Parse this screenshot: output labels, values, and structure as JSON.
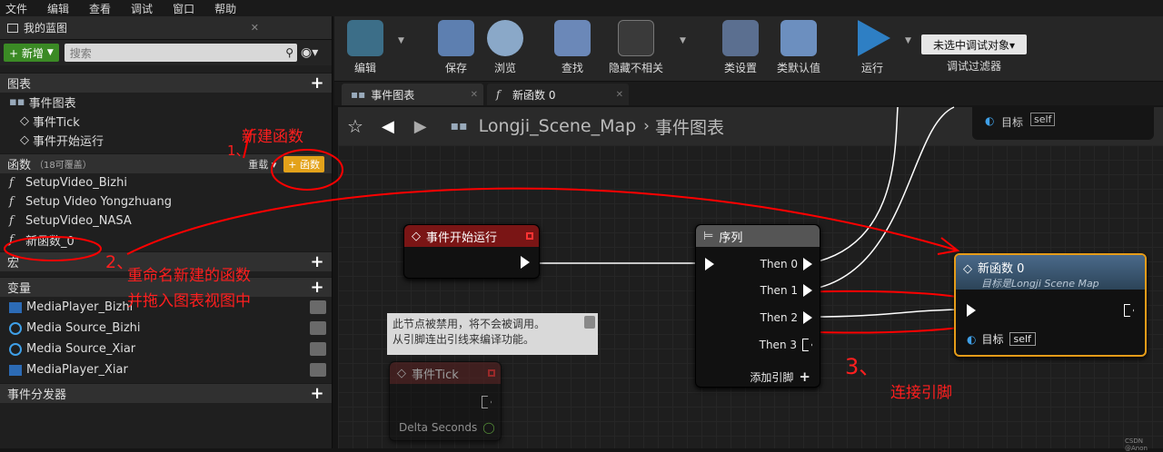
{
  "menu": [
    "文件",
    "编辑",
    "查看",
    "调试",
    "窗口",
    "帮助"
  ],
  "panel": {
    "title": "我的蓝图",
    "new_label": "+ 新增",
    "search_placeholder": "搜索",
    "graph_section": "图表",
    "event_graph": "事件图表",
    "event_tick": "事件Tick",
    "event_begin": "事件开始运行",
    "func_section": "函数",
    "func_note": "（18可覆盖）",
    "override": "重载",
    "add_func": "函数",
    "functions": [
      "SetupVideo_Bizhi",
      "Setup Video Yongzhuang",
      "SetupVideo_NASA",
      "新函数_0"
    ],
    "macro": "宏",
    "var_section": "变量",
    "variables": [
      "MediaPlayer_Bizhi",
      "Media Source_Bizhi",
      "Media Source_Xiar",
      "MediaPlayer_Xiar"
    ],
    "dispatcher": "事件分发器"
  },
  "toolbar": {
    "compile": "编辑",
    "save": "保存",
    "browse": "浏览",
    "find": "查找",
    "hide": "隐藏不相关",
    "class_settings": "类设置",
    "class_defaults": "类默认值",
    "play": "运行",
    "debug_select": "未选中调试对象▾",
    "debug_filter": "调试过滤器"
  },
  "tabs": [
    "事件图表",
    "新函数 0"
  ],
  "breadcrumb": {
    "map": "Longji_Scene_Map",
    "graph": "事件图表"
  },
  "nodes": {
    "begin": "事件开始运行",
    "seq": "序列",
    "then": [
      "Then 0",
      "Then 1",
      "Then 2",
      "Then 3"
    ],
    "add_pin": "添加引脚",
    "func": "新函数 0",
    "func_sub": "目标是Longji Scene Map",
    "target": "目标",
    "self": "self",
    "tick": "事件Tick",
    "delta": "Delta Seconds",
    "disabled_note": "此节点被禁用，将不会被调用。\n从引脚连出引线来编译功能。",
    "top_target": "目标",
    "top_self": "self"
  },
  "annotations": {
    "a1": "新建函数",
    "n1": "1、",
    "a2": "重命名新建的函数\n并拖入图表视图中",
    "n2": "2、",
    "a3": "连接引脚",
    "n3": "3、"
  },
  "watermark": "CSDN @Anon"
}
